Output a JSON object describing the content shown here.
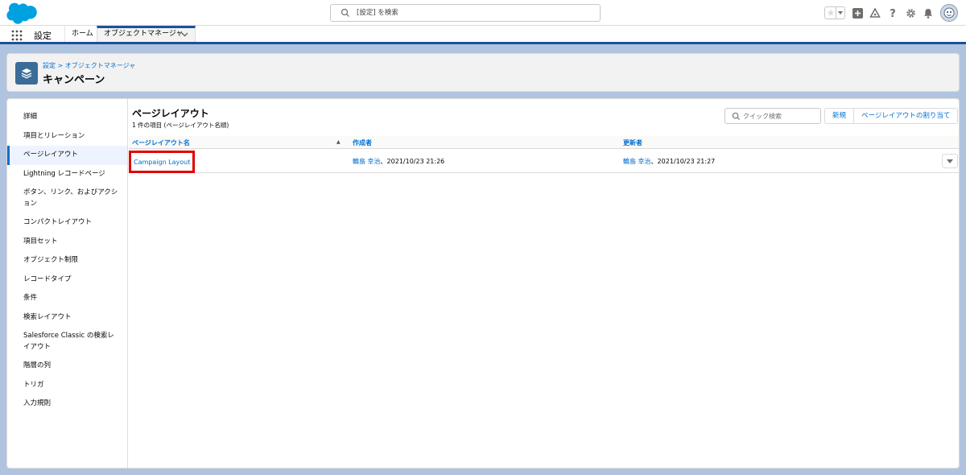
{
  "header": {
    "search_placeholder": "[設定] を検索"
  },
  "context_bar": {
    "app_name": "設定",
    "tabs": [
      {
        "label": "ホーム"
      },
      {
        "label": "オブジェクトマネージャ"
      }
    ]
  },
  "page_header": {
    "breadcrumb": "設定 > オブジェクトマネージャ",
    "title": "キャンペーン"
  },
  "sidebar": {
    "items": [
      {
        "label": "詳細"
      },
      {
        "label": "項目とリレーション"
      },
      {
        "label": "ページレイアウト",
        "active": true
      },
      {
        "label": "Lightning レコードページ"
      },
      {
        "label": "ボタン、リンク、およびアクション"
      },
      {
        "label": "コンパクトレイアウト"
      },
      {
        "label": "項目セット"
      },
      {
        "label": "オブジェクト制限"
      },
      {
        "label": "レコードタイプ"
      },
      {
        "label": "条件"
      },
      {
        "label": "検索レイアウト"
      },
      {
        "label": "Salesforce Classic の検索レイアウト"
      },
      {
        "label": "階層の列"
      },
      {
        "label": "トリガ"
      },
      {
        "label": "入力規則"
      }
    ]
  },
  "list": {
    "title": "ページレイアウト",
    "subtitle": "1 件の項目 (ページレイアウト名順)",
    "quick_search_placeholder": "クイック検索",
    "buttons": {
      "new": "新規",
      "assign": "ページレイアウトの割り当て"
    },
    "columns": [
      {
        "label": "ページレイアウト名"
      },
      {
        "label": "作成者"
      },
      {
        "label": "更新者"
      }
    ],
    "rows": [
      {
        "name": "Campaign Layout",
        "created_by": "輪島 幸治",
        "created_at": "、2021/10/23 21:26",
        "updated_by": "輪島 幸治",
        "updated_at": "、2021/10/23 21:27"
      }
    ]
  },
  "colors": {
    "brand": "#1b5297",
    "link": "#006dcc",
    "highlight_box": "#e00000",
    "object_icon": "#3b6c97"
  }
}
